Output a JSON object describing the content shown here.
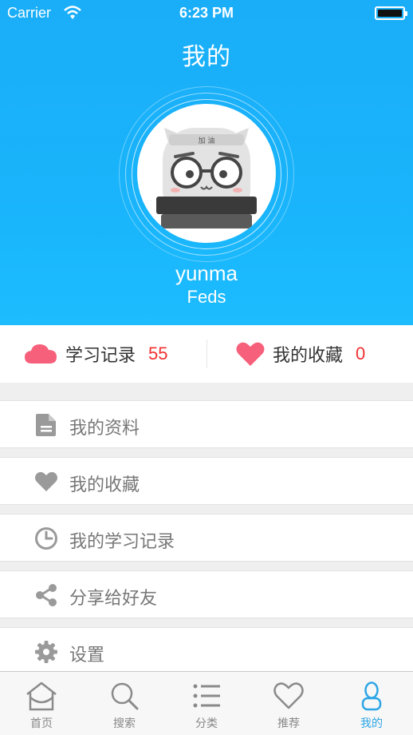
{
  "status_bar": {
    "carrier": "Carrier",
    "time": "6:23 PM"
  },
  "header": {
    "title": "我的"
  },
  "profile": {
    "username": "yunma",
    "organization": "Feds",
    "avatar_badge": "加 油"
  },
  "stats": {
    "study_records": {
      "label": "学习记录",
      "count": "55",
      "icon": "cloud-icon"
    },
    "favorites": {
      "label": "我的收藏",
      "count": "0",
      "icon": "heart-icon"
    }
  },
  "menu": {
    "items": [
      {
        "label": "我的资料",
        "icon": "document-icon"
      },
      {
        "label": "我的收藏",
        "icon": "heart-icon"
      },
      {
        "label": "我的学习记录",
        "icon": "clock-icon"
      },
      {
        "label": "分享给好友",
        "icon": "share-icon"
      },
      {
        "label": "设置",
        "icon": "gear-icon"
      }
    ]
  },
  "tabbar": {
    "tabs": [
      {
        "label": "首页",
        "icon": "home-icon",
        "active": false
      },
      {
        "label": "搜索",
        "icon": "search-icon",
        "active": false
      },
      {
        "label": "分类",
        "icon": "list-icon",
        "active": false
      },
      {
        "label": "推荐",
        "icon": "heart-outline-icon",
        "active": false
      },
      {
        "label": "我的",
        "icon": "user-icon",
        "active": true
      }
    ]
  },
  "colors": {
    "header_blue": "#1aaef8",
    "accent_pink": "#f7607a",
    "count_red": "#f23030",
    "active_tab": "#2da6e6",
    "menu_icon_gray": "#9a9a9a"
  }
}
